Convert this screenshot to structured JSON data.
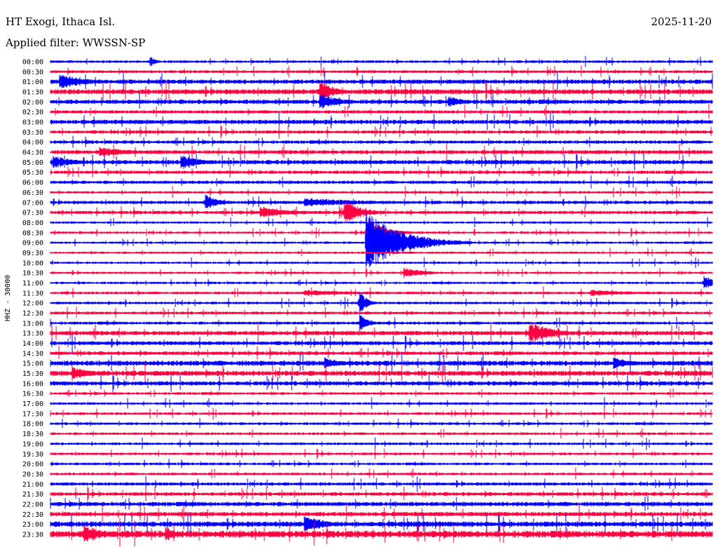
{
  "header": {
    "station": "HT Exogi, Ithaca Isl.",
    "date": "2025-11-20",
    "filter": "Applied filter: WWSSN-SP"
  },
  "chart_data": {
    "type": "line",
    "title": "HT Exogi, Ithaca Isl.",
    "ylabel": "HHZ - 30000",
    "minutes_per_row": 30,
    "colors": {
      "even": "#0000ff",
      "odd": "#ff0040"
    },
    "rows": [
      "00:00",
      "00:30",
      "01:00",
      "01:30",
      "02:00",
      "02:30",
      "03:00",
      "03:30",
      "04:00",
      "04:30",
      "05:00",
      "05:30",
      "06:00",
      "06:30",
      "07:00",
      "07:30",
      "08:00",
      "08:30",
      "09:00",
      "09:30",
      "10:00",
      "10:30",
      "11:00",
      "11:30",
      "12:00",
      "12:30",
      "13:00",
      "13:30",
      "14:00",
      "14:30",
      "15:00",
      "15:30",
      "16:00",
      "16:30",
      "17:00",
      "17:30",
      "18:00",
      "18:30",
      "19:00",
      "19:30",
      "20:00",
      "20:30",
      "21:00",
      "21:30",
      "22:00",
      "22:30",
      "23:00",
      "23:30"
    ],
    "noise_level": [
      1.6,
      1.8,
      2.6,
      3.0,
      2.6,
      2.0,
      2.6,
      2.0,
      2.0,
      2.4,
      2.6,
      2.0,
      2.0,
      1.6,
      2.0,
      2.0,
      1.4,
      1.4,
      1.4,
      1.4,
      1.4,
      1.4,
      1.4,
      1.6,
      1.6,
      1.8,
      1.8,
      2.6,
      2.4,
      2.2,
      3.0,
      3.0,
      2.6,
      1.6,
      1.6,
      1.6,
      1.6,
      1.6,
      1.6,
      1.6,
      1.6,
      1.6,
      2.0,
      2.2,
      2.6,
      2.6,
      3.2,
      4.0
    ],
    "events": [
      {
        "row": 0,
        "minute": 4.5,
        "amplitude": 9,
        "duration": 0.3
      },
      {
        "row": 2,
        "minute": 0.4,
        "amplitude": 12,
        "duration": 1.2
      },
      {
        "row": 3,
        "minute": 12.2,
        "amplitude": 20,
        "duration": 0.6
      },
      {
        "row": 4,
        "minute": 12.2,
        "amplitude": 14,
        "duration": 0.8
      },
      {
        "row": 4,
        "minute": 18,
        "amplitude": 9,
        "duration": 0.8
      },
      {
        "row": 9,
        "minute": 2.2,
        "amplitude": 8,
        "duration": 1.5
      },
      {
        "row": 10,
        "minute": 5.9,
        "amplitude": 11,
        "duration": 1.0
      },
      {
        "row": 10,
        "minute": 0.1,
        "amplitude": 10,
        "duration": 1.0
      },
      {
        "row": 14,
        "minute": 7.0,
        "amplitude": 14,
        "duration": 0.6
      },
      {
        "row": 14,
        "minute": 11.5,
        "amplitude": 7,
        "duration": 3.0
      },
      {
        "row": 15,
        "minute": 9.5,
        "amplitude": 9,
        "duration": 1.5
      },
      {
        "row": 15,
        "minute": 13.3,
        "amplitude": 20,
        "duration": 0.8
      },
      {
        "row": 17,
        "minute": 14.3,
        "amplitude": 22,
        "duration": 0.8
      },
      {
        "row": 18,
        "minute": 14.3,
        "amplitude": 45,
        "duration": 1.6
      },
      {
        "row": 21,
        "minute": 16.0,
        "amplitude": 8,
        "duration": 1.0
      },
      {
        "row": 22,
        "minute": 29.6,
        "amplitude": 12,
        "duration": 0.5
      },
      {
        "row": 23,
        "minute": 11.5,
        "amplitude": 5,
        "duration": 2.5
      },
      {
        "row": 23,
        "minute": 24.5,
        "amplitude": 5,
        "duration": 2.0
      },
      {
        "row": 24,
        "minute": 14.0,
        "amplitude": 22,
        "duration": 0.3
      },
      {
        "row": 26,
        "minute": 14.0,
        "amplitude": 14,
        "duration": 0.4
      },
      {
        "row": 27,
        "minute": 21.7,
        "amplitude": 16,
        "duration": 1.2
      },
      {
        "row": 30,
        "minute": 12.4,
        "amplitude": 10,
        "duration": 0.8
      },
      {
        "row": 30,
        "minute": 25.5,
        "amplitude": 9,
        "duration": 1.0
      },
      {
        "row": 31,
        "minute": 1.0,
        "amplitude": 10,
        "duration": 1.0
      },
      {
        "row": 46,
        "minute": 11.5,
        "amplitude": 14,
        "duration": 1.0
      },
      {
        "row": 47,
        "minute": 1.5,
        "amplitude": 14,
        "duration": 1.0
      },
      {
        "row": 47,
        "minute": 5.2,
        "amplitude": 12,
        "duration": 0.6
      }
    ]
  }
}
